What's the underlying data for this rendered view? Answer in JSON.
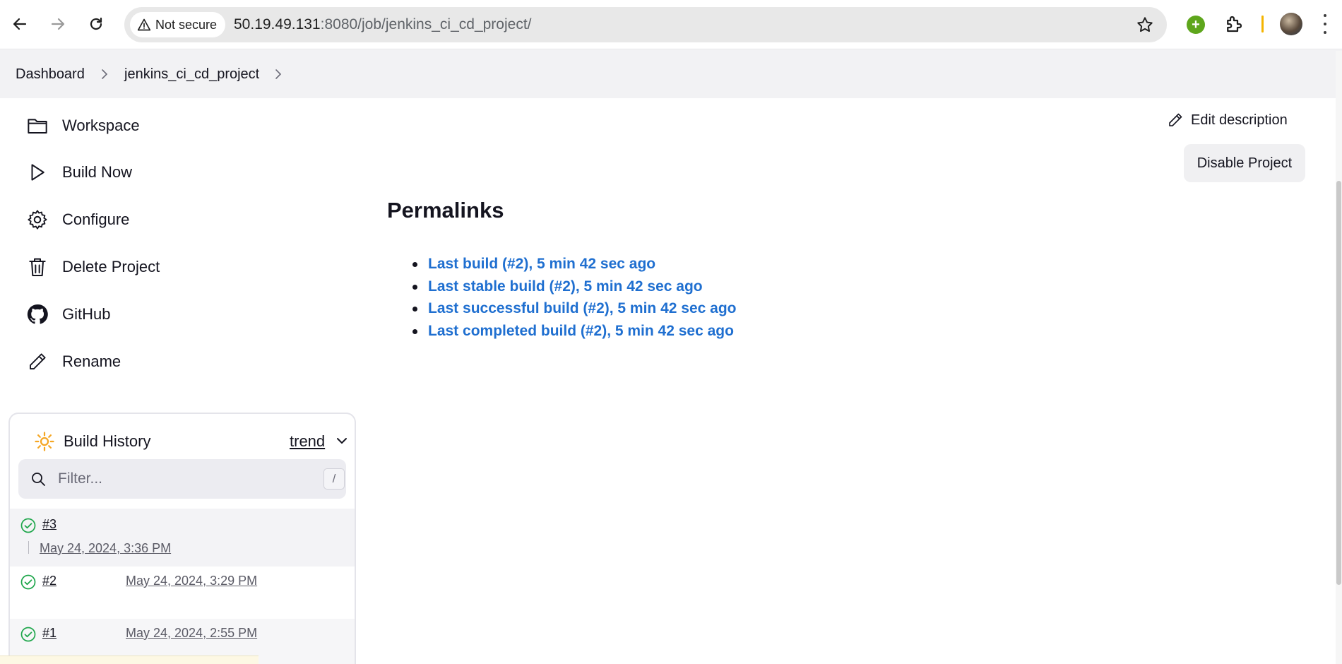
{
  "browser": {
    "security_chip": "Not secure",
    "url_host": "50.19.49.131",
    "url_rest": ":8080/job/jenkins_ci_cd_project/"
  },
  "breadcrumb": {
    "items": [
      "Dashboard",
      "jenkins_ci_cd_project"
    ]
  },
  "sidebar": {
    "tasks": [
      {
        "label": "Workspace",
        "icon": "folder-icon"
      },
      {
        "label": "Build Now",
        "icon": "play-icon"
      },
      {
        "label": "Configure",
        "icon": "gear-icon"
      },
      {
        "label": "Delete Project",
        "icon": "trash-icon"
      },
      {
        "label": "GitHub",
        "icon": "github-icon"
      },
      {
        "label": "Rename",
        "icon": "pencil-icon"
      }
    ]
  },
  "build_history": {
    "title": "Build History",
    "trend_label": "trend",
    "filter_placeholder": "Filter...",
    "filter_shortcut": "/",
    "builds": [
      {
        "number": "#3",
        "date": "May 24, 2024, 3:36 PM",
        "status": "success"
      },
      {
        "number": "#2",
        "date": "May 24, 2024, 3:29 PM",
        "status": "success"
      },
      {
        "number": "#1",
        "date": "May 24, 2024, 2:55 PM",
        "status": "success"
      }
    ]
  },
  "main": {
    "edit_description": "Edit description",
    "disable_project": "Disable Project",
    "permalinks_title": "Permalinks",
    "permalinks": [
      "Last build (#2), 5 min 42 sec ago",
      "Last stable build (#2), 5 min 42 sec ago",
      "Last successful build (#2), 5 min 42 sec ago",
      "Last completed build (#2), 5 min 42 sec ago"
    ]
  },
  "colors": {
    "link": "#1f6fd0",
    "success": "#1ea64b",
    "sun": "#f5a623"
  }
}
